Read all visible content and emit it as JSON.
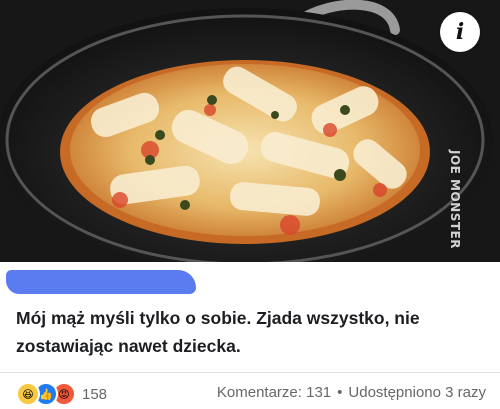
{
  "photo": {
    "watermark": "JOE MONSTER",
    "info_button_icon": "info-icon"
  },
  "post": {
    "author_redacted": true,
    "text": "Mój mąż myśli tylko o sobie. Zjada wszystko, nie zostawiając nawet dziecka."
  },
  "footer": {
    "reaction_icons": [
      "haha-reaction-icon",
      "like-reaction-icon",
      "angry-reaction-icon"
    ],
    "reaction_count": "158",
    "comments_label": "Komentarze: 131",
    "separator": "•",
    "shares_label": "Udostępniono 3 razy"
  },
  "colors": {
    "author_scribble": "#5b7cf0",
    "like": "#1f7bf2",
    "haha": "#f7c843",
    "angry": "#f0593a",
    "muted_text": "#65676b"
  }
}
